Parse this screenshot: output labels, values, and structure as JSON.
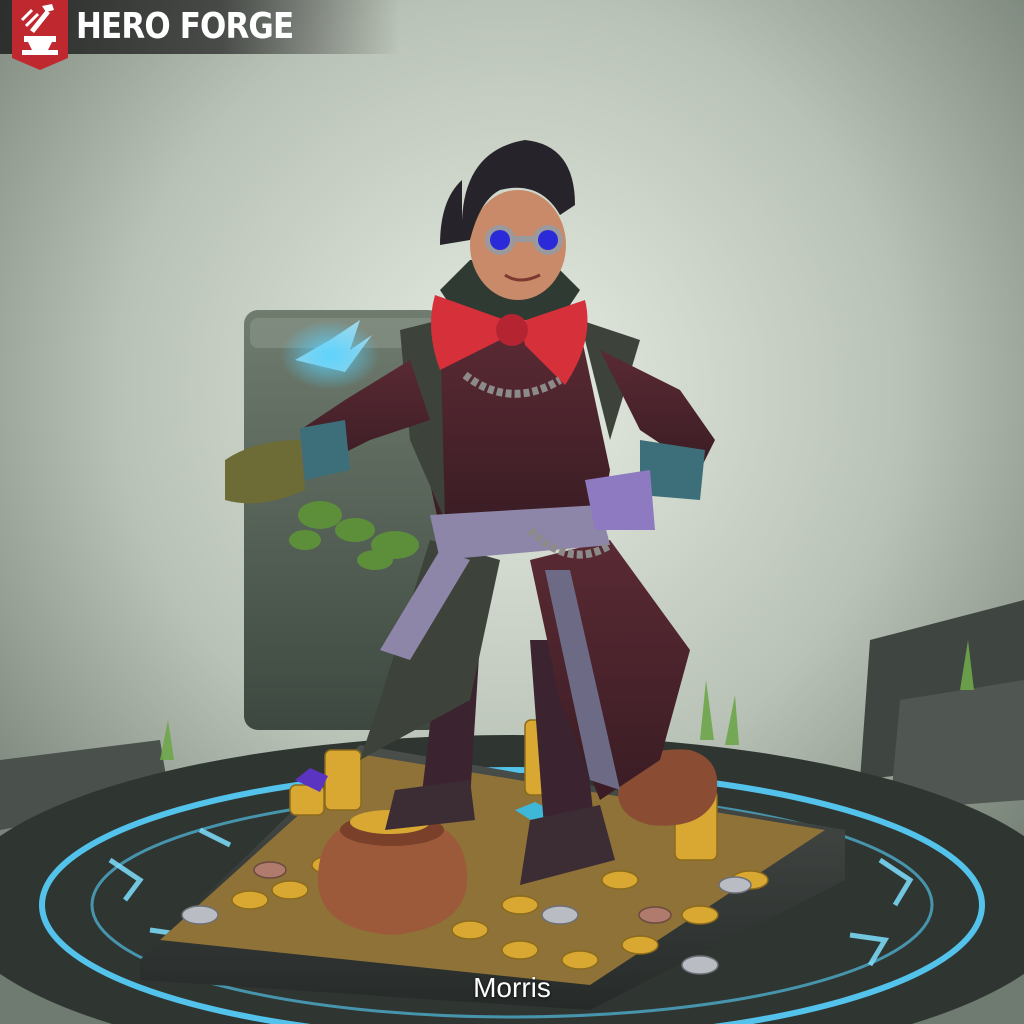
{
  "brand": {
    "name": "HERO FORGE"
  },
  "miniature": {
    "name": "Morris"
  },
  "colors": {
    "brand_red": "#c0282f",
    "rune_glow": "#59d3ff",
    "bowtie": "#d6313b",
    "goggle_lens": "#2a2ad8"
  },
  "icons": {
    "brand_logo": "anvil-hammer-icon"
  }
}
